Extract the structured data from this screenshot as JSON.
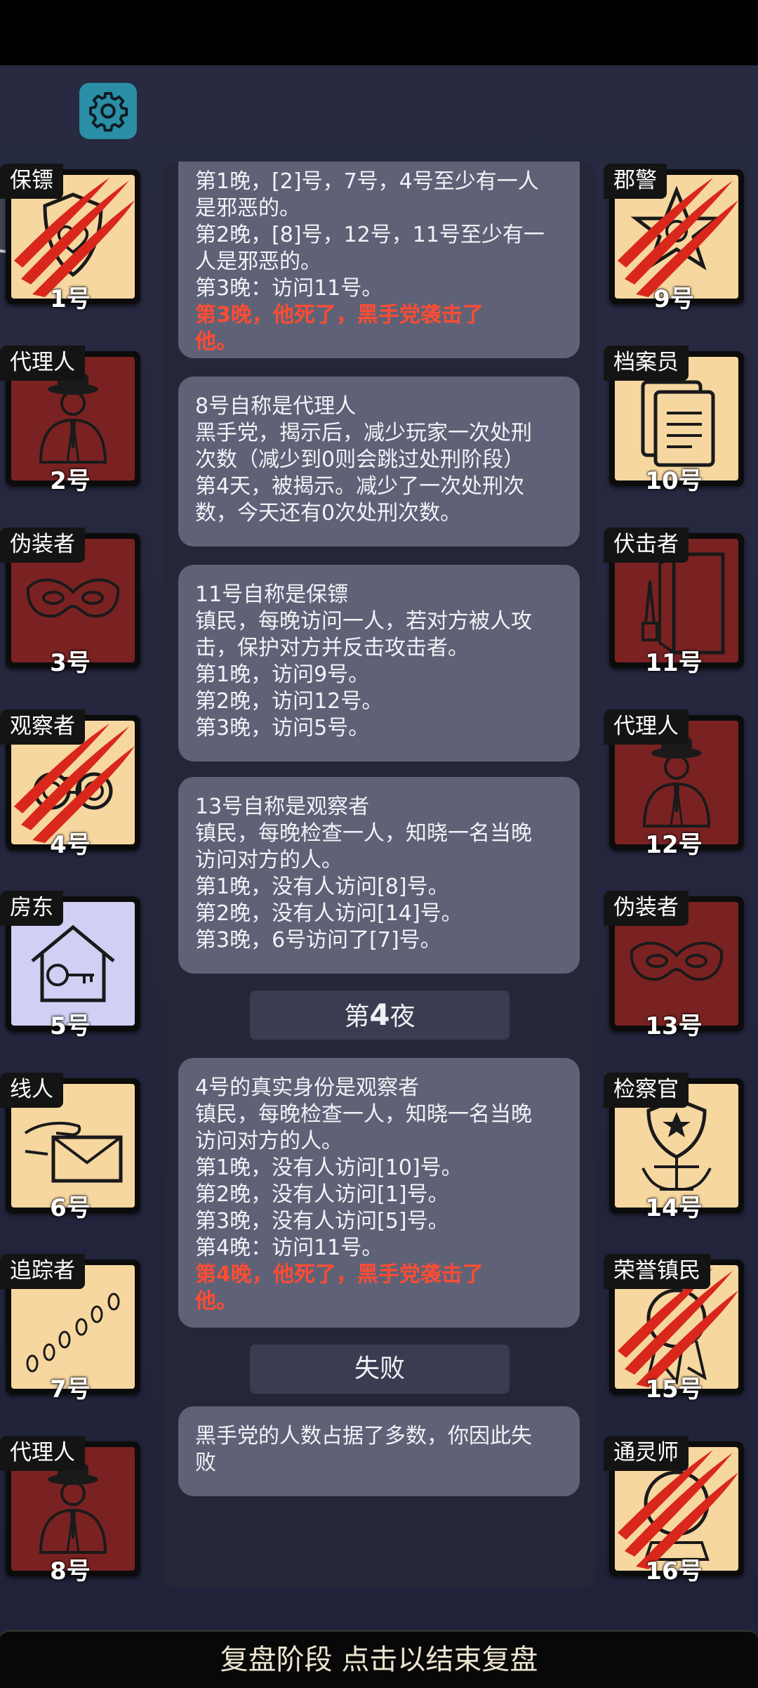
{
  "players_left": [
    {
      "role": "保镖",
      "number": "1号",
      "tile": "gold",
      "icon": "shield-heart-icon",
      "dead": true
    },
    {
      "role": "代理人",
      "number": "2号",
      "tile": "red",
      "icon": "agent-icon",
      "dead": false
    },
    {
      "role": "伪装者",
      "number": "3号",
      "tile": "red",
      "icon": "mask-icon",
      "dead": false
    },
    {
      "role": "观察者",
      "number": "4号",
      "tile": "gold",
      "icon": "binoculars-icon",
      "dead": true
    },
    {
      "role": "房东",
      "number": "5号",
      "tile": "lav",
      "icon": "house-key-icon",
      "dead": false
    },
    {
      "role": "线人",
      "number": "6号",
      "tile": "gold",
      "icon": "envelope-hand-icon",
      "dead": false
    },
    {
      "role": "追踪者",
      "number": "7号",
      "tile": "gold",
      "icon": "footprints-icon",
      "dead": false
    },
    {
      "role": "代理人",
      "number": "8号",
      "tile": "red",
      "icon": "agent-icon",
      "dead": false
    }
  ],
  "players_right": [
    {
      "role": "郡警",
      "number": "9号",
      "tile": "gold",
      "icon": "sheriff-star-icon",
      "dead": true
    },
    {
      "role": "档案员",
      "number": "10号",
      "tile": "gold",
      "icon": "documents-icon",
      "dead": false
    },
    {
      "role": "伏击者",
      "number": "11号",
      "tile": "red",
      "icon": "knife-door-icon",
      "dead": false
    },
    {
      "role": "代理人",
      "number": "12号",
      "tile": "red",
      "icon": "agent-icon",
      "dead": false
    },
    {
      "role": "伪装者",
      "number": "13号",
      "tile": "red",
      "icon": "mask-icon",
      "dead": false
    },
    {
      "role": "检察官",
      "number": "14号",
      "tile": "gold",
      "icon": "justice-emblem-icon",
      "dead": false
    },
    {
      "role": "荣誉镇民",
      "number": "15号",
      "tile": "gold",
      "icon": "medal-icon",
      "dead": true
    },
    {
      "role": "通灵师",
      "number": "16号",
      "tile": "gold",
      "icon": "crystal-ball-icon",
      "dead": true
    }
  ],
  "log": {
    "entry1": {
      "lines": [
        "第1晚，[2]号，7号，4号至少有一人",
        "是邪恶的。",
        "第2晚，[8]号，12号，11号至少有一",
        "人是邪恶的。",
        "第3晚：访问11号。"
      ],
      "death": [
        "第3晚，他死了，黑手党袭击了",
        "他。"
      ]
    },
    "entry2": {
      "lines": [
        "8号自称是代理人",
        "黑手党，揭示后，减少玩家一次处刑",
        "次数（减少到0则会跳过处刑阶段）",
        "第4天，被揭示。减少了一次处刑次",
        "数，今天还有0次处刑次数。"
      ]
    },
    "entry3": {
      "lines": [
        "11号自称是保镖",
        "镇民，每晚访问一人，若对方被人攻",
        "击，保护对方并反击攻击者。",
        "第1晚，访问9号。",
        "第2晚，访问12号。",
        "第3晚，访问5号。"
      ]
    },
    "entry4": {
      "lines": [
        "13号自称是观察者",
        "镇民，每晚检查一人，知晓一名当晚",
        "访问对方的人。",
        "第1晚，没有人访问[8]号。",
        "第2晚，没有人访问[14]号。",
        "第3晚，6号访问了[7]号。"
      ]
    },
    "night_header": {
      "prefix": "第",
      "number": "4",
      "suffix": "夜"
    },
    "entry5": {
      "lines": [
        "4号的真实身份是观察者",
        "镇民，每晚检查一人，知晓一名当晚",
        "访问对方的人。",
        "第1晚，没有人访问[10]号。",
        "第2晚，没有人访问[1]号。",
        "第3晚，没有人访问[5]号。",
        "第4晚：访问11号。"
      ],
      "death": [
        "第4晚，他死了，黑手党袭击了",
        "他。"
      ]
    },
    "result_header": "失败",
    "entry6": {
      "lines": [
        "黑手党的人数占据了多数，你因此失",
        "败"
      ]
    }
  },
  "bottom_bar": "复盘阶段 点击以结束复盘",
  "colors": {
    "gold_tile": "#f7d7a0",
    "red_tile": "#7a2222",
    "lavender_tile": "#cfd0f4",
    "death_text": "#ff4c33",
    "settings": "#2a8fa6"
  }
}
